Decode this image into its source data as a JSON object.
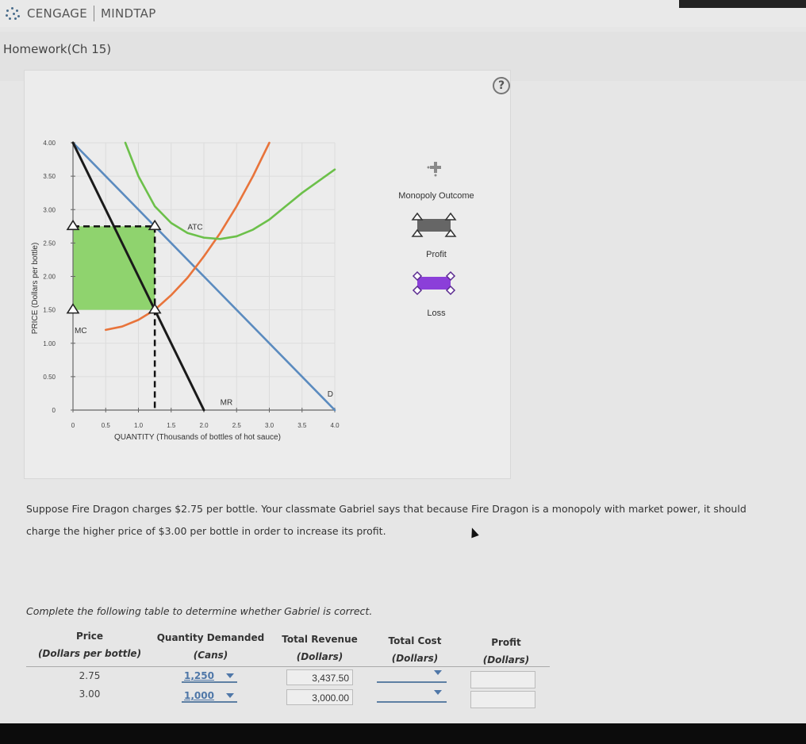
{
  "header": {
    "brand_left": "CENGAGE",
    "brand_right": "MINDTAP",
    "logo_icon": "cengage-dots-logo"
  },
  "assignment": {
    "title": "Homework(Ch 15)"
  },
  "help": {
    "icon": "question-mark-icon",
    "label": "?"
  },
  "legend": {
    "items": [
      {
        "label": "Monopoly Outcome",
        "icon": "crosshair-point-tool",
        "color": "#888888"
      },
      {
        "label": "Profit",
        "icon": "rectangle-triangle-handles",
        "color": "#666666"
      },
      {
        "label": "Loss",
        "icon": "rectangle-diamond-handles",
        "color": "#8b3fd9"
      }
    ]
  },
  "chart_data": {
    "type": "line",
    "title": "",
    "xlabel": "QUANTITY (Thousands of bottles of hot sauce)",
    "ylabel": "PRICE (Dollars per bottle)",
    "xlim": [
      0,
      4.0
    ],
    "ylim": [
      0,
      4.0
    ],
    "x_ticks": [
      "0",
      "0.5",
      "1.0",
      "1.5",
      "2.0",
      "2.5",
      "3.0",
      "3.5",
      "4.0"
    ],
    "y_ticks": [
      "0",
      "0.50",
      "1.00",
      "1.50",
      "2.00",
      "2.50",
      "3.00",
      "3.50",
      "4.00"
    ],
    "grid": true,
    "series": [
      {
        "name": "D",
        "label": "D",
        "color": "#5b8bbf",
        "points": [
          [
            0,
            4.0
          ],
          [
            4.0,
            0
          ]
        ]
      },
      {
        "name": "MR",
        "label": "MR",
        "color": "#1a1a1a",
        "points": [
          [
            0,
            4.0
          ],
          [
            2.0,
            0
          ]
        ]
      },
      {
        "name": "MC",
        "label": "MC",
        "color": "#e8743b",
        "points": [
          [
            0.5,
            1.2
          ],
          [
            0.75,
            1.25
          ],
          [
            1.0,
            1.35
          ],
          [
            1.25,
            1.5
          ],
          [
            1.5,
            1.72
          ],
          [
            1.75,
            1.98
          ],
          [
            2.0,
            2.3
          ],
          [
            2.25,
            2.65
          ],
          [
            2.5,
            3.05
          ],
          [
            2.75,
            3.5
          ],
          [
            3.0,
            4.0
          ]
        ]
      },
      {
        "name": "ATC",
        "label": "ATC",
        "color": "#6cc04a",
        "points": [
          [
            0.8,
            4.0
          ],
          [
            1.0,
            3.5
          ],
          [
            1.25,
            3.05
          ],
          [
            1.5,
            2.8
          ],
          [
            1.75,
            2.65
          ],
          [
            2.0,
            2.58
          ],
          [
            2.25,
            2.56
          ],
          [
            2.5,
            2.6
          ],
          [
            2.75,
            2.7
          ],
          [
            3.0,
            2.85
          ],
          [
            3.25,
            3.05
          ],
          [
            3.5,
            3.25
          ],
          [
            4.0,
            3.6
          ]
        ]
      }
    ],
    "profit_area": {
      "x": [
        0,
        1.25
      ],
      "y": [
        1.5,
        2.75
      ],
      "color": "#8fd36e"
    },
    "dashed_lines": [
      {
        "from": [
          0,
          2.75
        ],
        "to": [
          1.25,
          2.75
        ]
      },
      {
        "from": [
          1.25,
          2.75
        ],
        "to": [
          1.25,
          0
        ]
      }
    ],
    "markers": [
      {
        "x": 0,
        "y": 2.75
      },
      {
        "x": 1.25,
        "y": 2.75
      },
      {
        "x": 0,
        "y": 1.5
      },
      {
        "x": 1.25,
        "y": 1.5
      }
    ]
  },
  "question": {
    "text": "Suppose Fire Dragon charges $2.75 per bottle. Your classmate Gabriel says that because Fire Dragon is a monopoly with market power, it should charge the higher price of $3.00 per bottle in order to increase its profit.",
    "instruction": "Complete the following table to determine whether Gabriel is correct."
  },
  "table": {
    "headers": [
      {
        "title": "Price",
        "sub": "(Dollars per bottle)"
      },
      {
        "title": "Quantity Demanded",
        "sub": "(Cans)"
      },
      {
        "title": "Total Revenue",
        "sub": "(Dollars)"
      },
      {
        "title": "Total Cost",
        "sub": "(Dollars)"
      },
      {
        "title": "Profit",
        "sub": "(Dollars)"
      }
    ],
    "rows": [
      {
        "price": "2.75",
        "quantity": "1,250",
        "total_revenue": "3,437.50",
        "total_cost": "",
        "profit": ""
      },
      {
        "price": "3.00",
        "quantity": "1,000",
        "total_revenue": "3,000.00",
        "total_cost": "",
        "profit": ""
      }
    ]
  }
}
